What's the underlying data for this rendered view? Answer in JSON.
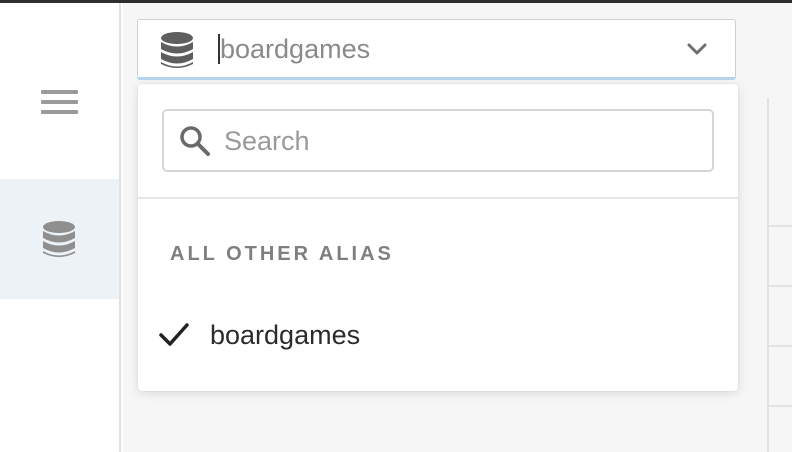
{
  "sidebar": {
    "menu_icon": "hamburger-menu-icon",
    "items": [
      {
        "icon": "database-icon",
        "active": true
      }
    ]
  },
  "alias_select": {
    "value": "boardgames",
    "icon": "database-icon",
    "toggle_icon": "chevron-down-icon"
  },
  "dropdown": {
    "search": {
      "placeholder": "Search",
      "value": "",
      "icon": "search-icon"
    },
    "section_header": "ALL OTHER ALIAS",
    "options": [
      {
        "label": "boardgames",
        "selected": true,
        "icon": "checkmark-icon"
      }
    ]
  },
  "colors": {
    "topbar": "#2e2e2e",
    "sidebar_active_bg": "#edf2f7",
    "icon_gray": "#8f8f8f",
    "focus_underline": "#b7d5ec",
    "text_dark": "#2b2b2b",
    "text_muted": "#8a8a8a"
  }
}
